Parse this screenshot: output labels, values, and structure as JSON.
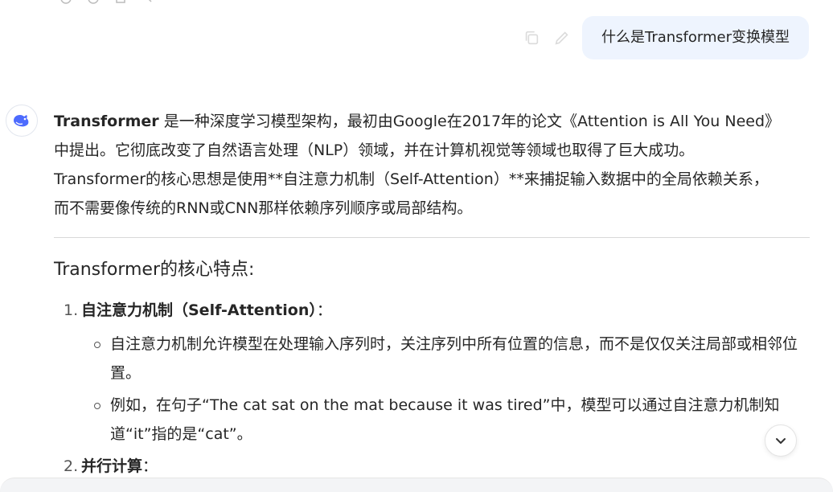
{
  "user_message": {
    "text": "什么是Transformer变换模型"
  },
  "assistant": {
    "intro_bold": "Transformer",
    "intro_line1_rest": " 是一种深度学习模型架构，最初由Google在2017年的论文《Attention is All You Need》",
    "intro_line2": "中提出。它彻底改变了自然语言处理（NLP）领域，并在计算机视觉等领域也取得了巨大成功。",
    "intro_line3": "Transformer的核心思想是使用**自注意力机制（Self-Attention）**来捕捉输入数据中的全局依赖关系，",
    "intro_line4": "而不需要像传统的RNN或CNN那样依赖序列顺序或局部结构。",
    "section_heading": "Transformer的核心特点:",
    "features": [
      {
        "num": "1.",
        "title": "自注意力机制（Self-Attention）",
        "suffix": "：",
        "bullets": [
          "自注意力机制允许模型在处理输入序列时，关注序列中所有位置的信息，而不是仅仅关注局部或相邻位置。",
          "例如，在句子“The cat sat on the mat because it was tired”中，模型可以通过自注意力机制知道“it”指的是“cat”。"
        ]
      },
      {
        "num": "2.",
        "title": "并行计算",
        "suffix": "："
      }
    ]
  },
  "icons": {
    "copy": "copy-icon",
    "edit": "edit-icon",
    "scroll_down": "chevron-down-icon",
    "avatar": "deepseek-whale-logo"
  },
  "colors": {
    "user_bubble": "#eef4fe",
    "text": "#262626",
    "avatar_logo": "#4d6bfe"
  }
}
